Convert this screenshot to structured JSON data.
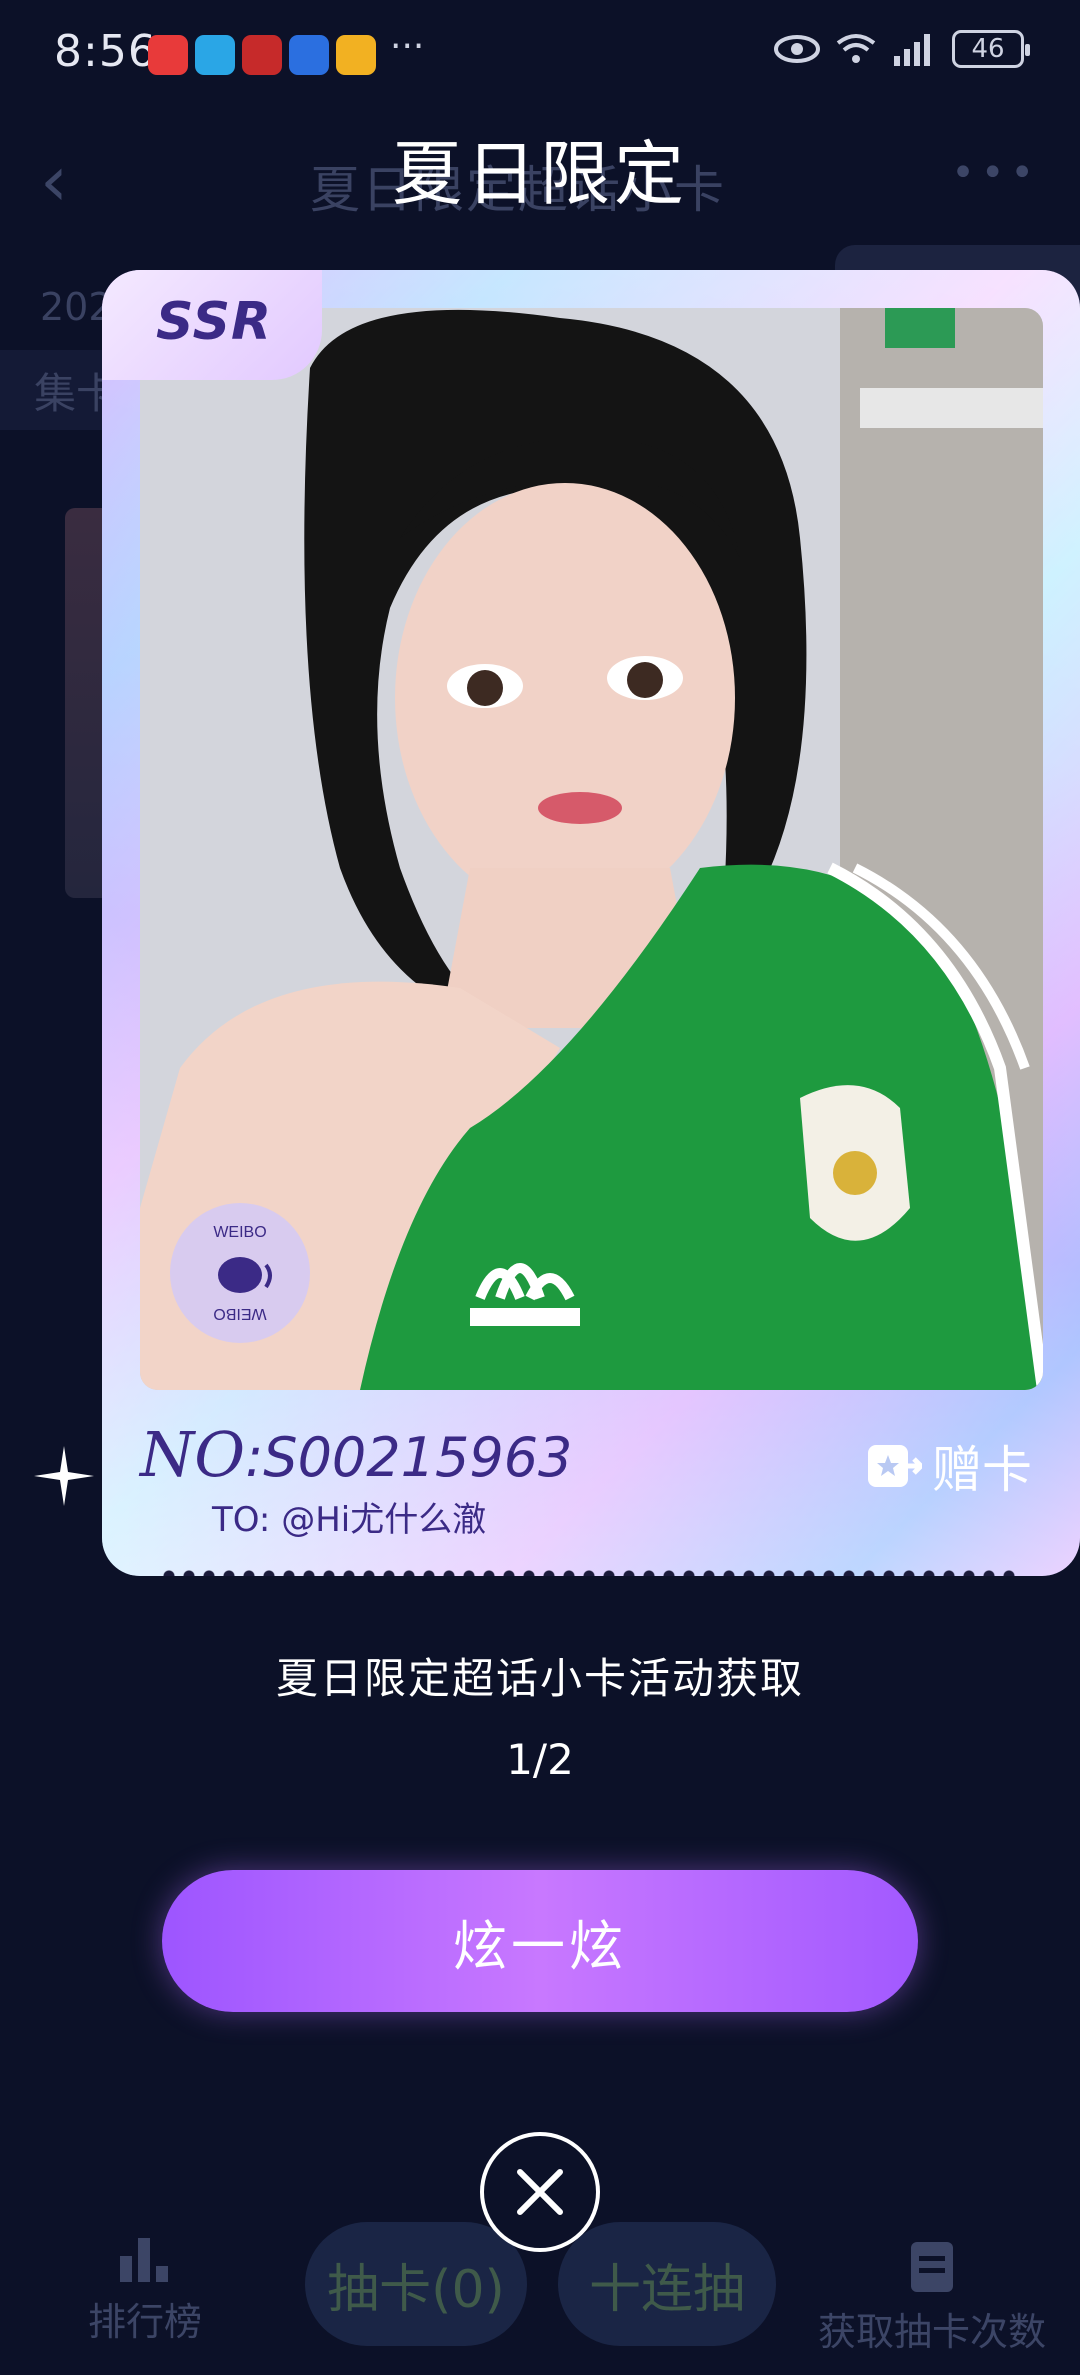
{
  "status_bar": {
    "time": "8:56",
    "more_notifications": "···",
    "battery": "46"
  },
  "background_page": {
    "title": "夏日限定超话小卡",
    "year_prefix": "202",
    "band_label": "集卡",
    "bottom_nav": {
      "ranking": "排行榜",
      "draw": "抽卡(0)",
      "ten_draw": "十连抽",
      "get_chances": "获取抽卡次数"
    }
  },
  "modal": {
    "title": "夏日限定",
    "card": {
      "rarity": "SSR",
      "number_prefix": "NO",
      "number_value": ":S00215963",
      "to_label": "TO: @Hi尤什么澈",
      "gift_label": "赠卡",
      "stamp_text": "WEIBO"
    },
    "caption": "夏日限定超话小卡活动获取",
    "pager": "1/2",
    "show_button": "炫一炫"
  },
  "colors": {
    "background": "#0c1128",
    "accent_purple": "#a259ff",
    "card_text": "#3b2a86",
    "jersey_green": "#1e9a3f"
  }
}
